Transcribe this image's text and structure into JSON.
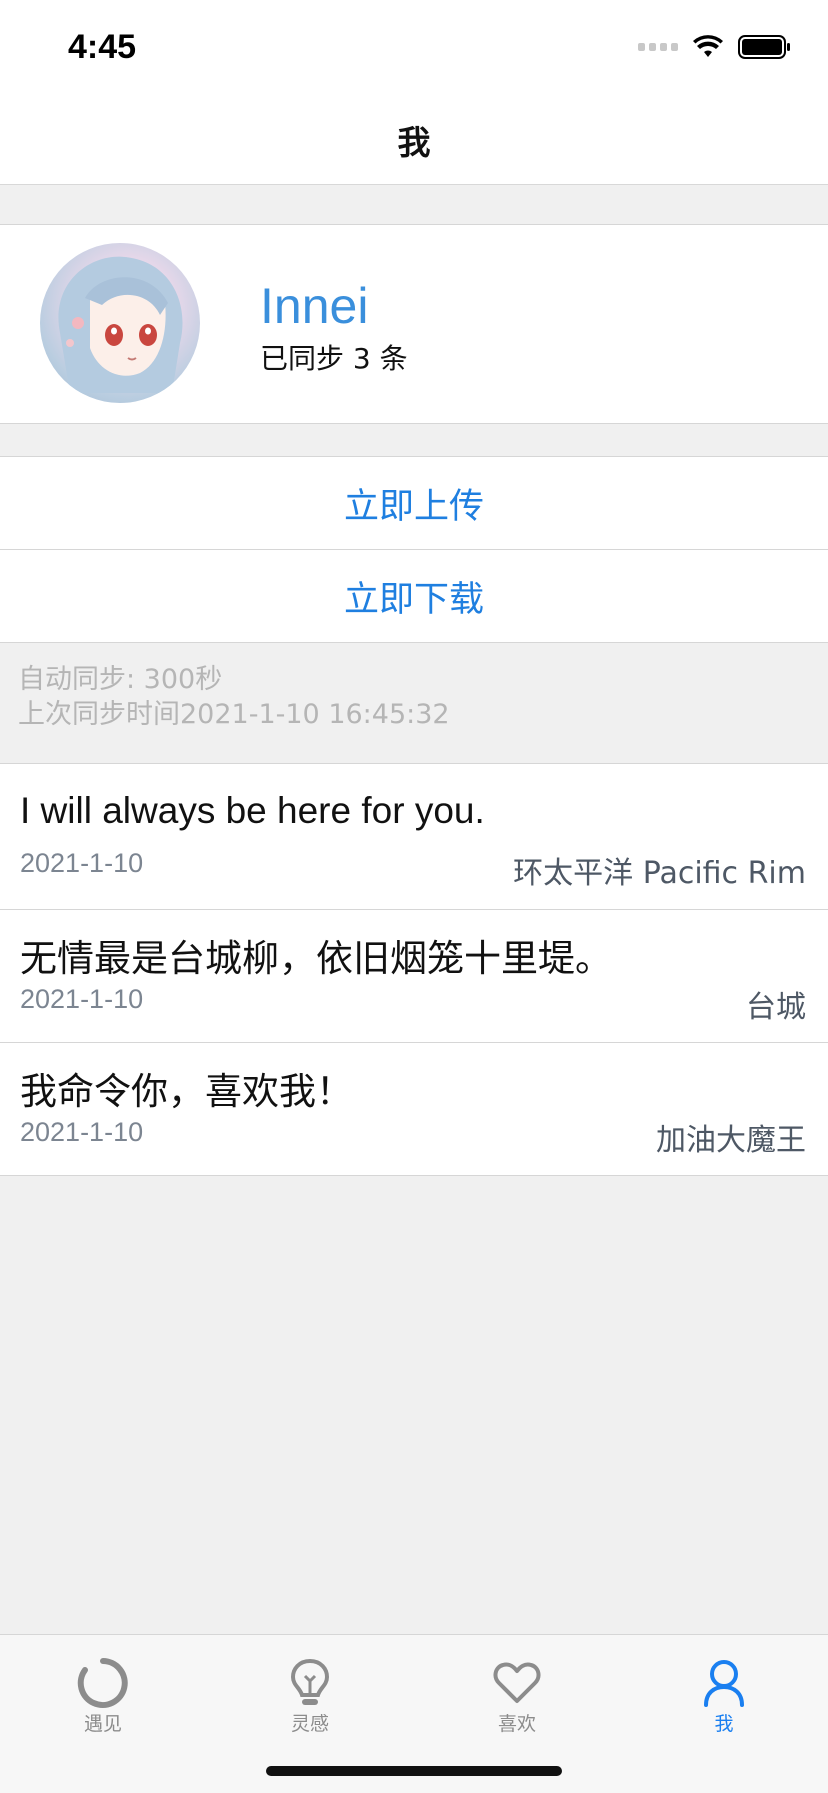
{
  "status_bar": {
    "time": "4:45"
  },
  "nav": {
    "title": "我"
  },
  "profile": {
    "name": "Innei",
    "sync_count": "已同步 3 条"
  },
  "actions": {
    "upload_label": "立即上传",
    "download_label": "立即下载"
  },
  "sync_info": {
    "auto_sync": "自动同步: 300秒",
    "last_sync": "上次同步时间2021-1-10 16:45:32"
  },
  "quotes": [
    {
      "text": "I will always be here for you.",
      "date": "2021-1-10",
      "source": "环太平洋 Pacific Rim"
    },
    {
      "text": "无情最是台城柳，依旧烟笼十里堤。",
      "date": "2021-1-10",
      "source": "台城"
    },
    {
      "text": "我命令你，喜欢我！",
      "date": "2021-1-10",
      "source": "加油大魔王"
    }
  ],
  "tabs": [
    {
      "label": "遇见",
      "icon": "circle-ring-icon",
      "active": false
    },
    {
      "label": "灵感",
      "icon": "lightbulb-icon",
      "active": false
    },
    {
      "label": "喜欢",
      "icon": "heart-icon",
      "active": false
    },
    {
      "label": "我",
      "icon": "person-icon",
      "active": true
    }
  ],
  "colors": {
    "accent": "#1a7ff0",
    "name": "#3a8fdc",
    "background": "#f0f0f0"
  }
}
